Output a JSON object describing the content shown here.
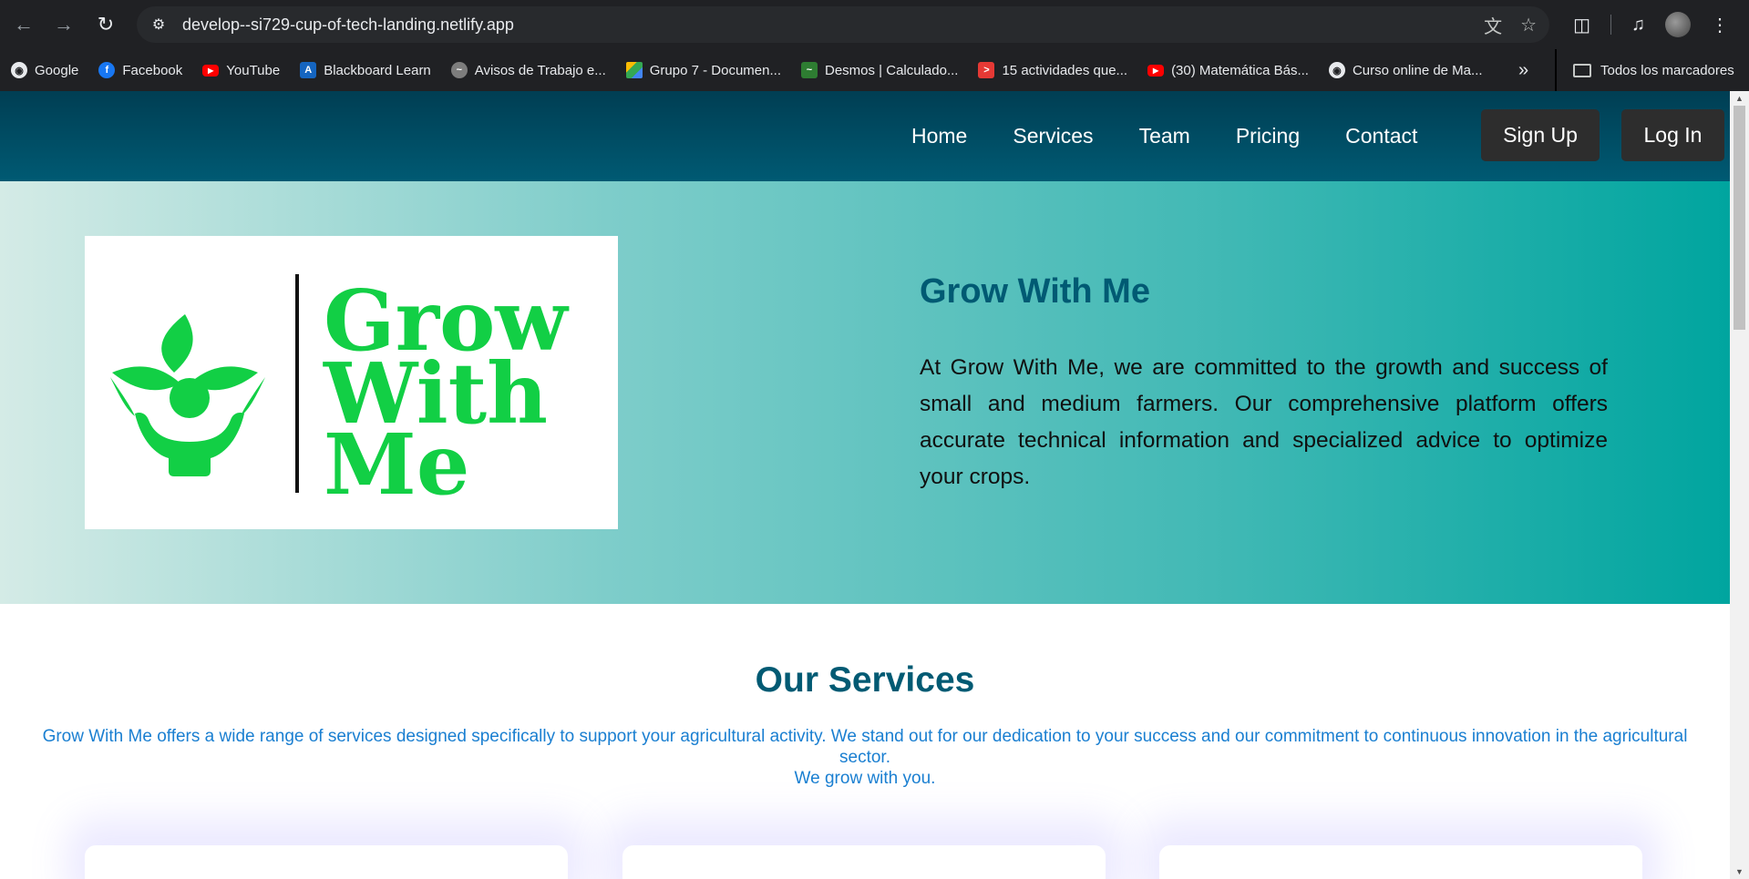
{
  "browser": {
    "url": "develop--si729-cup-of-tech-landing.netlify.app",
    "icons": [
      "back-icon",
      "forward-icon",
      "reload-icon",
      "site-info-icon",
      "translate-icon",
      "star-icon",
      "extensions-icon",
      "media-icon",
      "profile-avatar",
      "menu-icon"
    ],
    "bookmarks": [
      {
        "label": "Google",
        "icon": "globe-icon",
        "color": "#e8eaed"
      },
      {
        "label": "Facebook",
        "icon": "facebook-icon",
        "color": "#1877f2"
      },
      {
        "label": "YouTube",
        "icon": "youtube-icon",
        "color": "#ff0000"
      },
      {
        "label": "Blackboard Learn",
        "icon": "blackboard-icon",
        "color": "#1565c0"
      },
      {
        "label": "Avisos de Trabajo e...",
        "icon": "jobs-icon",
        "color": "#9e9e9e"
      },
      {
        "label": "Grupo 7 - Documen...",
        "icon": "drive-icon",
        "color": "#34a853"
      },
      {
        "label": "Desmos | Calculado...",
        "icon": "desmos-icon",
        "color": "#2e7d32"
      },
      {
        "label": "15 actividades que...",
        "icon": "arrow-icon",
        "color": "#e53935"
      },
      {
        "label": "(30) Matemática Bás...",
        "icon": "youtube-icon",
        "color": "#ff0000"
      },
      {
        "label": "Curso online de Ma...",
        "icon": "globe-icon",
        "color": "#e8eaed"
      }
    ],
    "more": "»",
    "all_bookmarks": "Todos los marcadores"
  },
  "site": {
    "nav": {
      "links": [
        "Home",
        "Services",
        "Team",
        "Pricing",
        "Contact"
      ],
      "signup": "Sign Up",
      "login": "Log In"
    },
    "hero": {
      "logo_text": [
        "Grow",
        "With",
        "Me"
      ],
      "title": "Grow With Me",
      "text": "At Grow With Me, we are committed to the growth and success of small and medium farmers. Our comprehensive platform offers accurate technical information and specialized advice to optimize your crops."
    },
    "services": {
      "title": "Our Services",
      "desc_line1": "Grow With Me offers a wide range of services designed specifically to support your agricultural activity. We stand out for our dedication to your success and our commitment to continuous innovation in the agricultural sector.",
      "desc_line2": "We grow with you."
    },
    "colors": {
      "brand_dark": "#005a73",
      "logo_green": "#12cf45",
      "link_blue": "#1a7fd1"
    }
  }
}
